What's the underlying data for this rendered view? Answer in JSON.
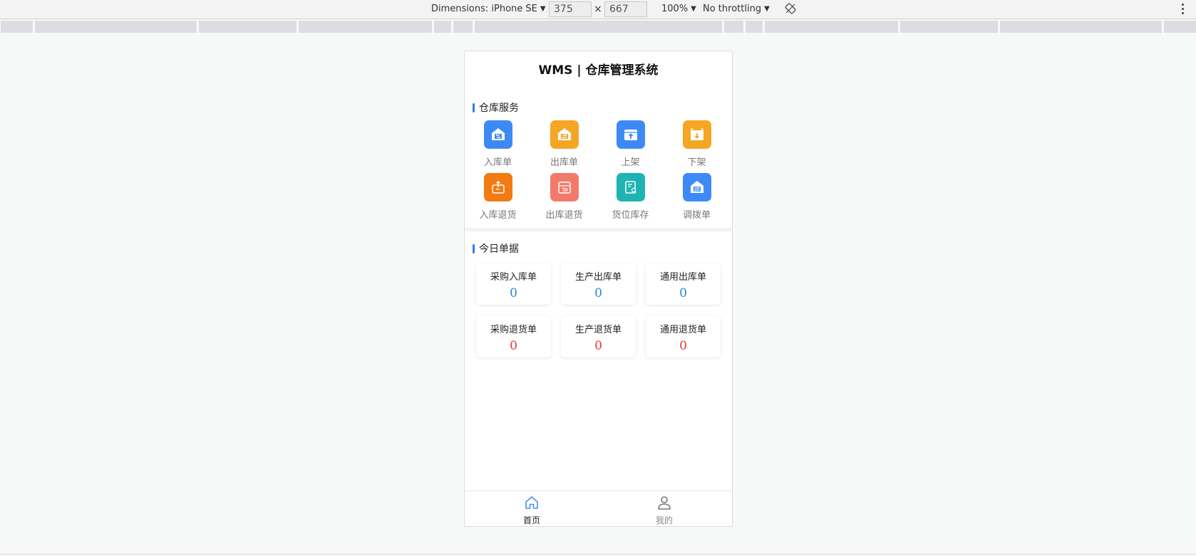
{
  "devtools": {
    "device_label": "Dimensions: iPhone SE",
    "width_value": "375",
    "height_value": "667",
    "times_sign": "×",
    "zoom": "100%",
    "throttling": "No throttling"
  },
  "app": {
    "title": "WMS | 仓库管理系统",
    "services_heading": "仓库服务",
    "services": [
      {
        "label": "入库单",
        "icon": "warehouse-in-icon",
        "color": "#3d8af7"
      },
      {
        "label": "出库单",
        "icon": "warehouse-out-icon",
        "color": "#f5a623"
      },
      {
        "label": "上架",
        "icon": "shelf-up-icon",
        "color": "#3d8af7"
      },
      {
        "label": "下架",
        "icon": "shelf-down-icon",
        "color": "#f5a623"
      },
      {
        "label": "入库退货",
        "icon": "inbound-return-icon",
        "color": "#f47a12"
      },
      {
        "label": "出库退货",
        "icon": "outbound-return-icon",
        "color": "#f27a6b"
      },
      {
        "label": "货位库存",
        "icon": "location-stock-icon",
        "color": "#1fb3b3"
      },
      {
        "label": "调拨单",
        "icon": "transfer-icon",
        "color": "#3d8af7"
      }
    ],
    "today_heading": "今日单据",
    "today_cards": [
      {
        "title": "采购入库单",
        "value": "0",
        "color": "#1e88e5"
      },
      {
        "title": "生产出库单",
        "value": "0",
        "color": "#1e88e5"
      },
      {
        "title": "通用出库单",
        "value": "0",
        "color": "#1e88e5"
      },
      {
        "title": "采购退货单",
        "value": "0",
        "color": "#e53935"
      },
      {
        "title": "生产退货单",
        "value": "0",
        "color": "#e53935"
      },
      {
        "title": "通用退货单",
        "value": "0",
        "color": "#e53935"
      }
    ],
    "tabs": [
      {
        "label": "首页",
        "icon": "home-icon",
        "active": true
      },
      {
        "label": "我的",
        "icon": "user-icon",
        "active": false
      }
    ],
    "accent": "#2b7ef1"
  }
}
